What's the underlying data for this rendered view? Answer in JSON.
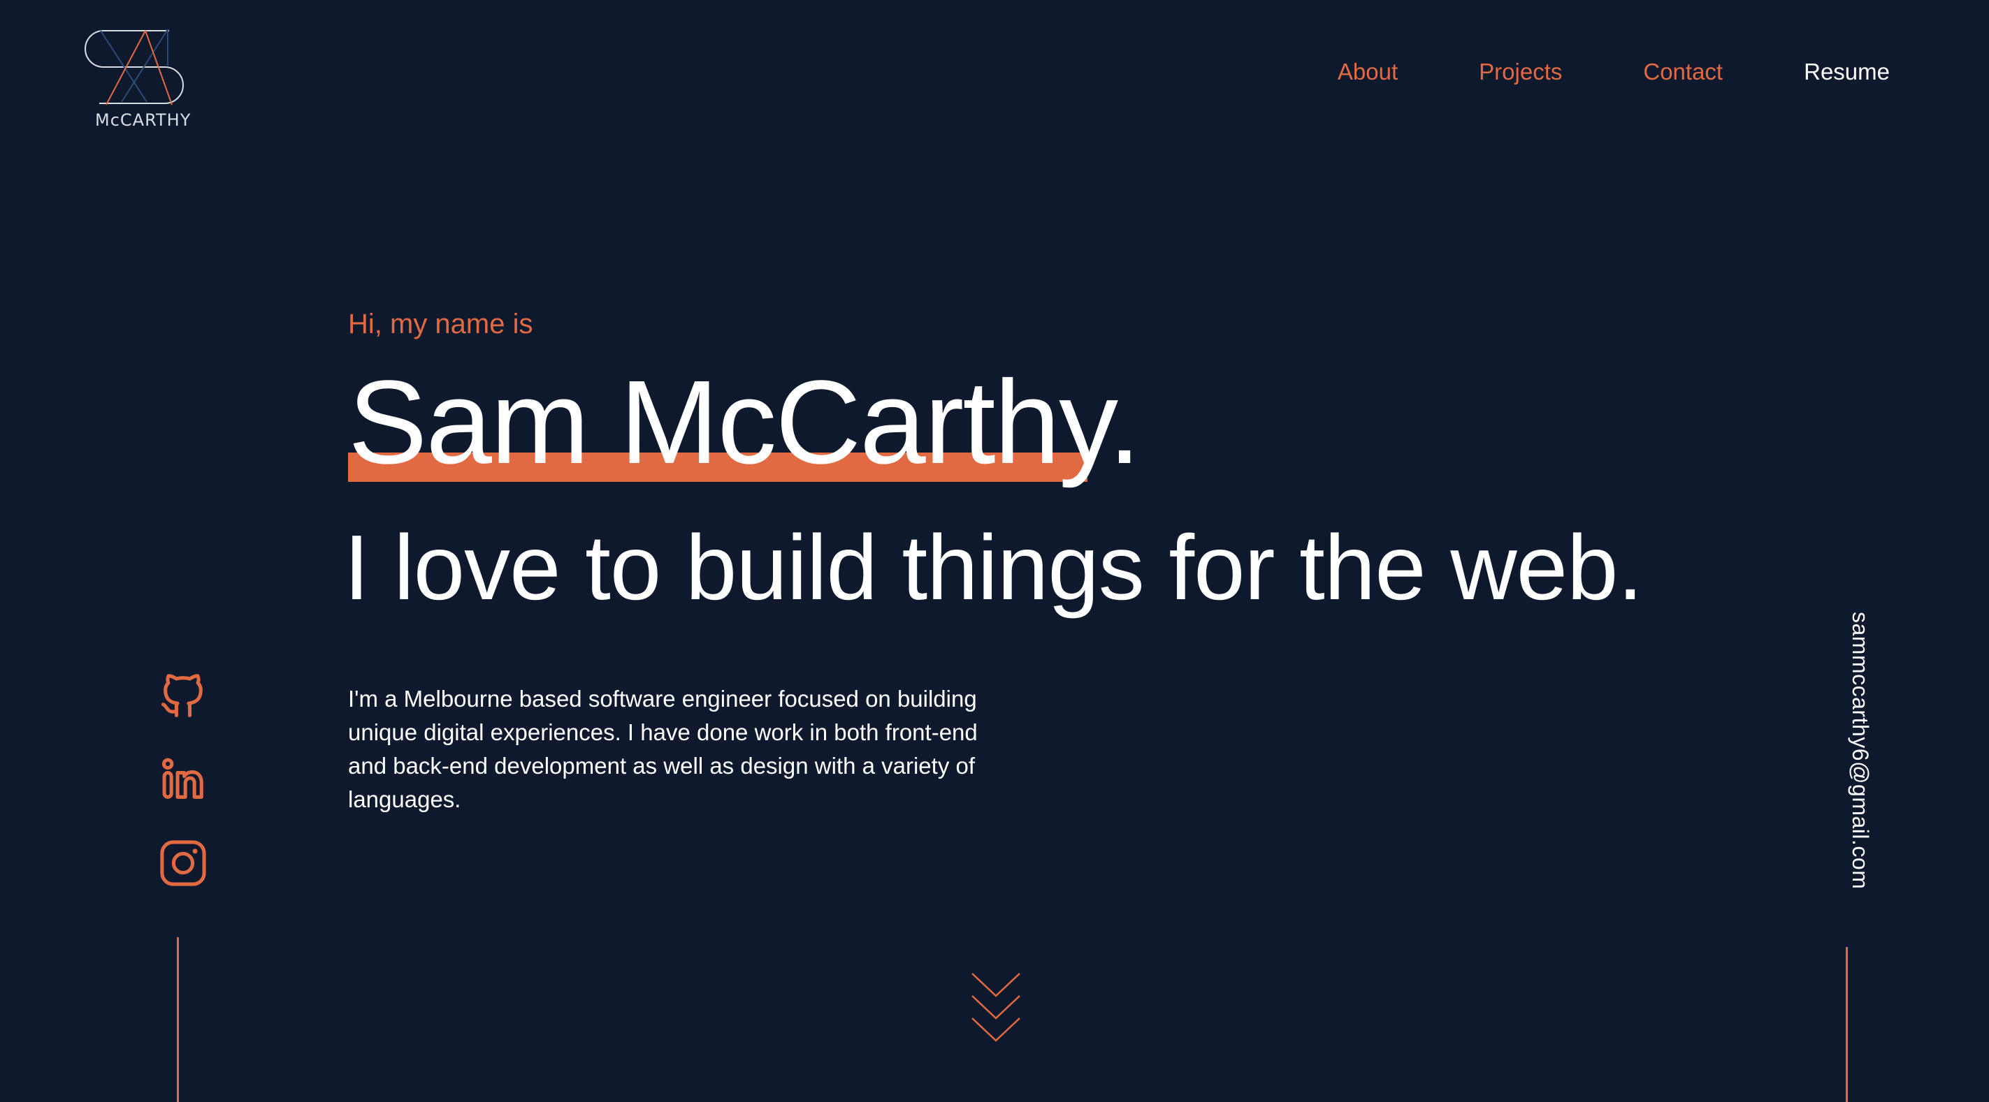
{
  "brand": {
    "logo_text": "McCARTHY"
  },
  "nav": {
    "about": "About",
    "projects": "Projects",
    "contact": "Contact",
    "resume": "Resume"
  },
  "hero": {
    "greeting": "Hi, my name is",
    "name": "Sam McCarthy.",
    "tagline": "I love to build things for the web.",
    "bio": "I'm a Melbourne based software engineer focused on building unique digital experiences. I have done work in both front-end and back-end development as well as design with a variety of languages."
  },
  "social": {
    "icons": [
      "github-icon",
      "linkedin-icon",
      "instagram-icon"
    ]
  },
  "contact": {
    "email": "sammccarthy6@gmail.com"
  },
  "colors": {
    "background": "#0f192d",
    "accent": "#e26a43",
    "text": "#ffffff"
  }
}
